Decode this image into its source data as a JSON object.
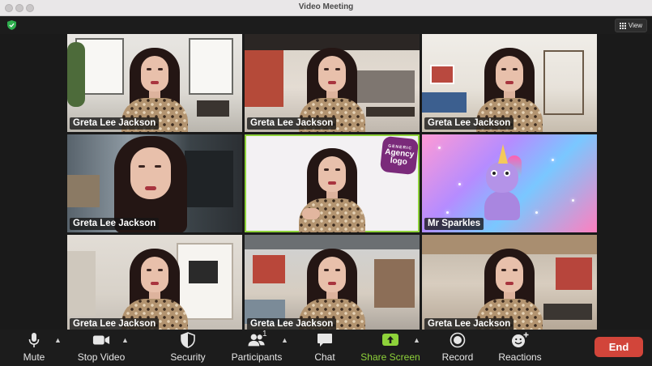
{
  "window": {
    "title": "Video Meeting"
  },
  "topbar": {
    "view_label": "View"
  },
  "participants": [
    {
      "name": "Greta Lee Jackson",
      "background": "loft office"
    },
    {
      "name": "Greta Lee Jackson",
      "background": "open office"
    },
    {
      "name": "Greta Lee Jackson",
      "background": "living room"
    },
    {
      "name": "Greta Lee Jackson",
      "background": "kitchen"
    },
    {
      "name": "",
      "background": "agency logo"
    },
    {
      "name": "Mr Sparkles",
      "background": "unicorn avatar"
    },
    {
      "name": "Greta Lee Jackson",
      "background": "modern room"
    },
    {
      "name": "Greta Lee Jackson",
      "background": "conference room"
    },
    {
      "name": "Greta Lee Jackson",
      "background": "wood office"
    }
  ],
  "logo": {
    "line1": "GENERIC",
    "line2": "Agency",
    "line3": "logo"
  },
  "toolbar": {
    "mute": "Mute",
    "stop_video": "Stop Video",
    "security": "Security",
    "participants": "Participants",
    "participants_count": "1",
    "chat": "Chat",
    "share_screen": "Share Screen",
    "record": "Record",
    "reactions": "Reactions",
    "end": "End"
  },
  "colors": {
    "accent_green": "#8ed23a",
    "end_red": "#d2453a"
  }
}
